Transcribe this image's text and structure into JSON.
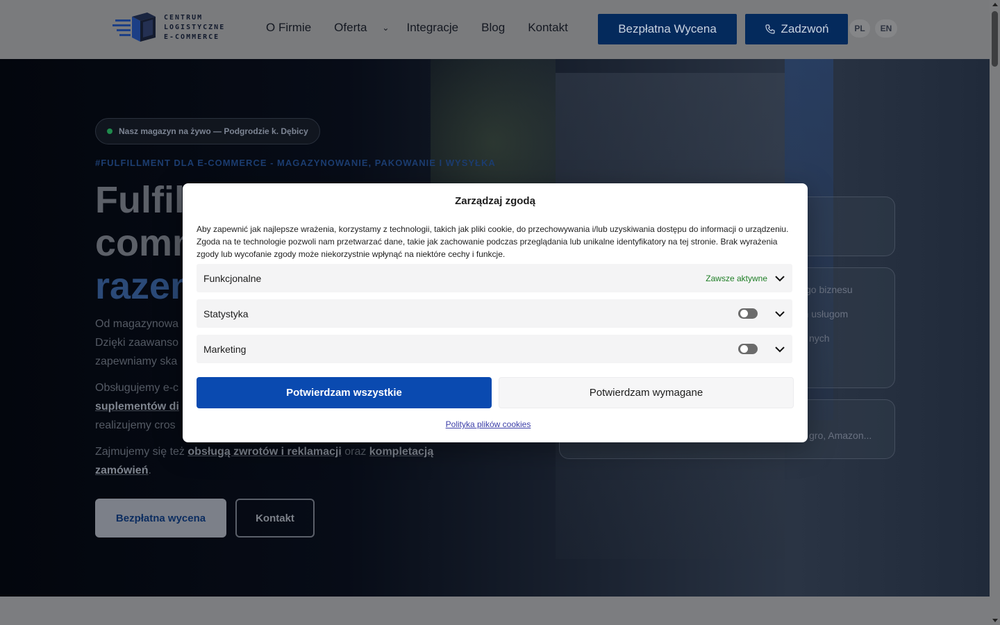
{
  "header": {
    "logo_lines": [
      "CENTRUM",
      "LOGISTYCZNE",
      "E-COMMERCE"
    ],
    "nav": [
      "O Firmie",
      "Oferta",
      "Integracje",
      "Blog",
      "Kontakt"
    ],
    "quote_button": "Bezpłatna Wycena",
    "call_button": "Zadzwoń",
    "languages": [
      "PL",
      "EN"
    ]
  },
  "hero": {
    "live_badge": "Nasz magazyn na żywo — Podgrodzie k. Dębicy",
    "eyebrow": "#FULFILLMENT DLA E-COMMERCE - MAGAZYNOWANIE, PAKOWANIE I WYSYŁKA",
    "title_lines": [
      "Fulfil",
      "comm",
      "razem"
    ],
    "p1_lines": [
      "Od magazynowa",
      "Dzięki zaawanso",
      "zapewniamy ska"
    ],
    "p2_lines": [
      "Obsługujemy e-c",
      "suplementów di",
      "realizujemy cros"
    ],
    "p3_prefix": "Zajmujemy się też ",
    "p3_link1": "obsługą zwrotów i reklamacji",
    "p3_mid": " oraz ",
    "p3_link2a": "kompletacją",
    "p3_link2b": "zamówień",
    "p3_suffix": ".",
    "btn_quote": "Bezpłatna wycena",
    "btn_contact": "Kontakt",
    "card_snippets": [
      "go biznesu",
      "rm usługom",
      "nych",
      "gro, Amazon..."
    ]
  },
  "consent": {
    "title": "Zarządzaj zgodą",
    "text": "Aby zapewnić jak najlepsze wrażenia, korzystamy z technologii, takich jak pliki cookie, do przechowywania i/lub uzyskiwania dostępu do informacji o urządzeniu. Zgoda na te technologie pozwoli nam przetwarzać dane, takie jak zachowanie podczas przeglądania lub unikalne identyfikatory na tej stronie. Brak wyrażenia zgody lub wycofanie zgody może niekorzystnie wpłynąć na niektóre cechy i funkcje.",
    "categories": [
      {
        "label": "Funkcjonalne",
        "status": "Zawsze aktywne"
      },
      {
        "label": "Statystyka",
        "enabled": false
      },
      {
        "label": "Marketing",
        "enabled": false
      }
    ],
    "accept_all": "Potwierdzam wszystkie",
    "accept_required": "Potwierdzam wymagane",
    "policy_link": "Polityka plików cookies"
  },
  "colors": {
    "brand_navy": "#042a5c",
    "primary_button": "#0a4ab0",
    "always_active": "#1e7e25",
    "live_dot": "#1f8a4c"
  }
}
